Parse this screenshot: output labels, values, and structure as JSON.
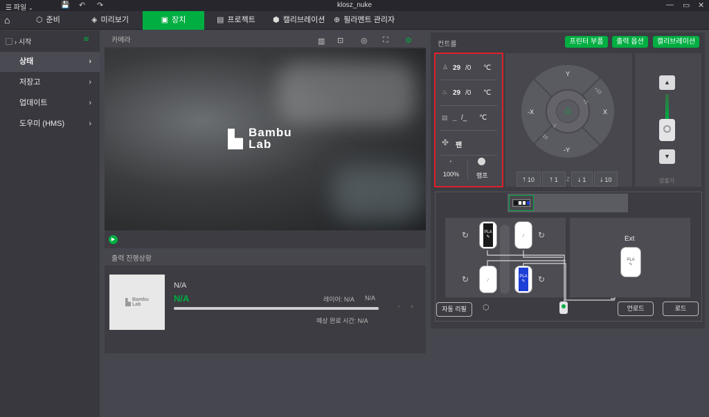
{
  "titlebar": {
    "file_menu": "파일",
    "title": "klosz_nuke"
  },
  "nav": {
    "prepare": "준비",
    "preview": "미리보기",
    "device": "장치",
    "project": "프로젝트",
    "calibration": "캘리브레이션",
    "filament_manager": "필라멘트 관리자"
  },
  "sidebar": {
    "printer_label": "시작",
    "items": [
      {
        "label": "상태"
      },
      {
        "label": "저장고"
      },
      {
        "label": "업데이트"
      },
      {
        "label": "도우미 (HMS)"
      }
    ]
  },
  "camera": {
    "title": "카메라",
    "logo_line1": "Bambu",
    "logo_line2": "Lab"
  },
  "progress": {
    "title": "출력 진행상황",
    "thumb_logo_line1": "Bambu",
    "thumb_logo_line2": "Lab",
    "file_name": "N/A",
    "status": "N/A",
    "layer_label": "레이어: N/A",
    "layer_value": "N/A",
    "eta_label": "예상 완료 시간: N/A",
    "percent": 0
  },
  "control": {
    "title": "컨트롤",
    "buttons": {
      "printer_parts": "프린터 부품",
      "print_options": "출력 옵션",
      "calibration": "캘리브레이션"
    },
    "nozzle_temp": "29",
    "nozzle_target": "/0",
    "nozzle_unit": "℃",
    "bed_temp": "29",
    "bed_target": "/0",
    "bed_unit": "℃",
    "chamber_temp": "_",
    "chamber_target": "/_",
    "chamber_unit": "℃",
    "fan_label": "팬",
    "speed_value": "100%",
    "lamp_label": "램프",
    "jog": {
      "up": "Y",
      "down": "-Y",
      "left": "-X",
      "right": "X",
      "step_big_ne": "+10",
      "step_small_ne": "+1",
      "step_small_sw": "-1",
      "step_big_sw": "-10"
    },
    "z_buttons": [
      "10",
      "1",
      "1",
      "10"
    ],
    "z_label": "Z",
    "extruder_label": "압출기",
    "ams": {
      "slots": [
        {
          "type": "PLA",
          "color": "#1a1a1a"
        },
        {
          "type": "",
          "color": "#ffffff"
        },
        {
          "type": "",
          "color": "#ffffff"
        },
        {
          "type": "PLA",
          "color": "#1c3fd6"
        }
      ],
      "ext_label": "Ext",
      "ext_spool_type": "PLA",
      "auto_refill": "자동 리필",
      "unload": "언로드",
      "load": "로드"
    }
  },
  "colors": {
    "accent": "#00ae42",
    "highlight_box": "#e0202a"
  }
}
